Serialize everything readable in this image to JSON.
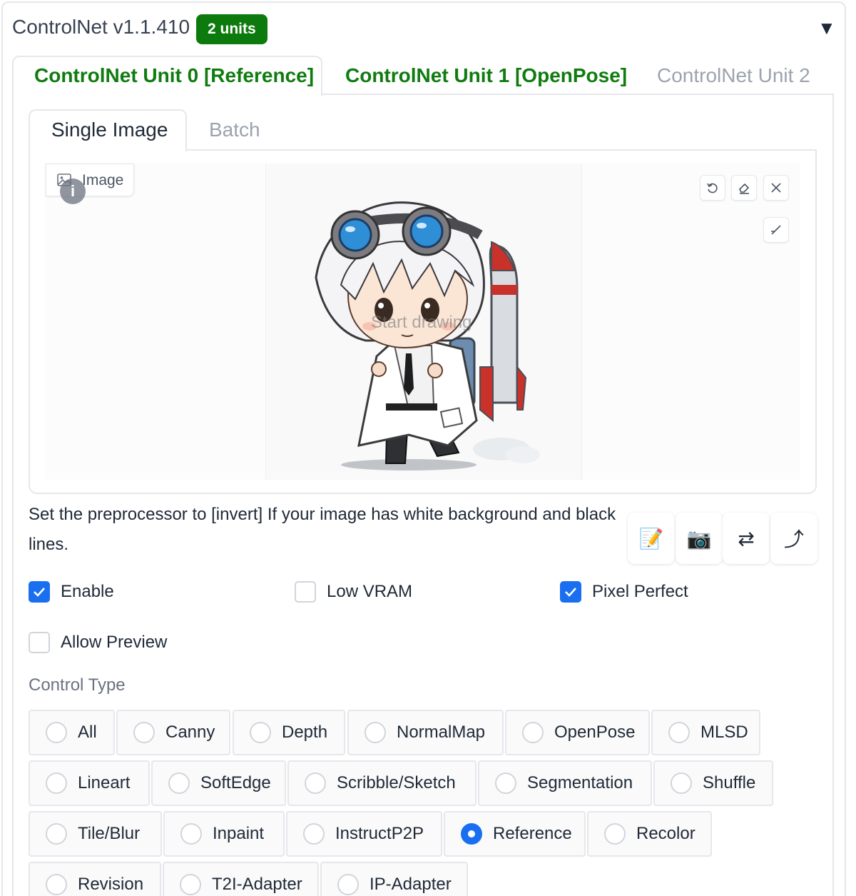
{
  "header": {
    "title": "ControlNet v1.1.410",
    "units_badge": "2 units",
    "collapse_glyph": "▼"
  },
  "unit_tabs": [
    {
      "label": "ControlNet Unit 0 [Reference]",
      "active": true
    },
    {
      "label": "ControlNet Unit 1 [OpenPose]",
      "active": false
    },
    {
      "label": "ControlNet Unit 2",
      "active": false
    }
  ],
  "image_tabs": [
    {
      "label": "Single Image",
      "active": true
    },
    {
      "label": "Batch",
      "active": false
    }
  ],
  "canvas": {
    "image_label": "Image",
    "info_glyph": "i",
    "placeholder": "Start drawing",
    "tools": [
      "undo-icon",
      "eraser-icon",
      "close-icon",
      "brush-icon"
    ]
  },
  "hint_text": "Set the preprocessor to [invert] If your image has white background and black lines.",
  "action_buttons": [
    {
      "name": "new-canvas-button",
      "glyph": "📝"
    },
    {
      "name": "webcam-button",
      "glyph": "📷"
    },
    {
      "name": "mirror-webcam-button",
      "glyph": "⇄"
    },
    {
      "name": "send-dimensions-button",
      "glyph": "⤴"
    }
  ],
  "options": {
    "enable": {
      "label": "Enable",
      "checked": true
    },
    "low_vram": {
      "label": "Low VRAM",
      "checked": false
    },
    "pixel_perfect": {
      "label": "Pixel Perfect",
      "checked": true
    },
    "allow_preview": {
      "label": "Allow Preview",
      "checked": false
    }
  },
  "control_type": {
    "label": "Control Type",
    "selected": "Reference",
    "options": [
      "All",
      "Canny",
      "Depth",
      "NormalMap",
      "OpenPose",
      "MLSD",
      "Lineart",
      "SoftEdge",
      "Scribble/Sketch",
      "Segmentation",
      "Shuffle",
      "Tile/Blur",
      "Inpaint",
      "InstructP2P",
      "Reference",
      "Recolor",
      "Revision",
      "T2I-Adapter",
      "IP-Adapter"
    ]
  },
  "colors": {
    "accent_green": "#107c10",
    "badge_green": "#0c7a0c",
    "check_blue": "#1a6ff0"
  }
}
